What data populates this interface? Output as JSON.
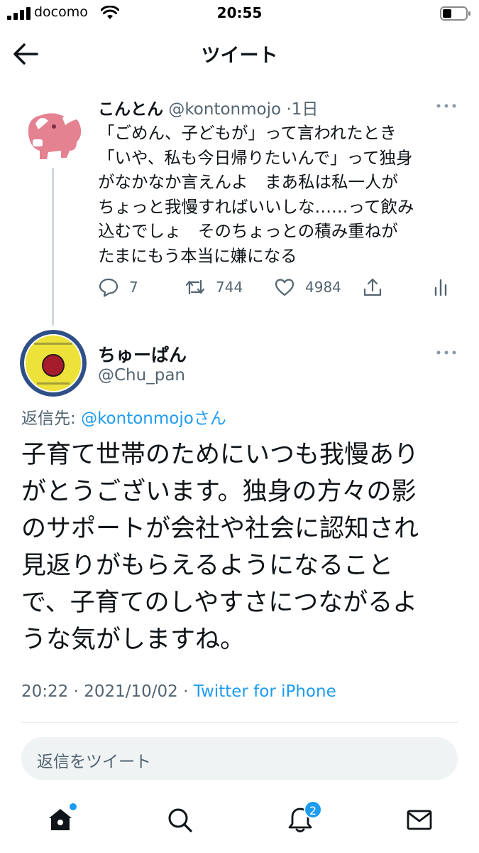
{
  "status_bar": {
    "carrier": "docomo",
    "time": "20:55"
  },
  "header": {
    "title": "ツイート",
    "back_icon": "arrow-left-icon"
  },
  "parent_tweet": {
    "display_name": "こんとん",
    "handle": "@kontonmojo",
    "separator": "·",
    "age": "1日",
    "text": "「ごめん、子どもが」って言われたとき\n「いや、私も今日帰りたいんで」って独身\nがなかなか言えんよ　まあ私は私一人が\nちょっと我慢すればいいしな……って飲み\n込むでしょ　そのちょっとの積み重ねが\nたまにもう本当に嫌になる",
    "actions": {
      "reply_count": "7",
      "retweet_count": "744",
      "like_count": "4984"
    }
  },
  "main_tweet": {
    "display_name": "ちゅーぱん",
    "handle": "@Chu_pan",
    "reply_to_label": "返信先: ",
    "reply_to_user": "@kontonmojoさん",
    "text": "子育て世帯のためにいつも我慢あり\nがとうございます。独身の方々の影\nのサポートが会社や社会に認知され\n見返りがもらえるようになること\nで、子育てのしやすさにつながるよ\nうな気がしますね。",
    "time": "20:22",
    "date": "2021/10/02",
    "source": "Twitter for iPhone",
    "separator": " · "
  },
  "reply_input": {
    "placeholder": "返信をツイート"
  },
  "bottom_nav": {
    "notification_badge": "2",
    "accent": "#1d9bf0"
  },
  "colors": {
    "text": "#0f1419",
    "secondary": "#536471",
    "link": "#1d9bf0"
  }
}
